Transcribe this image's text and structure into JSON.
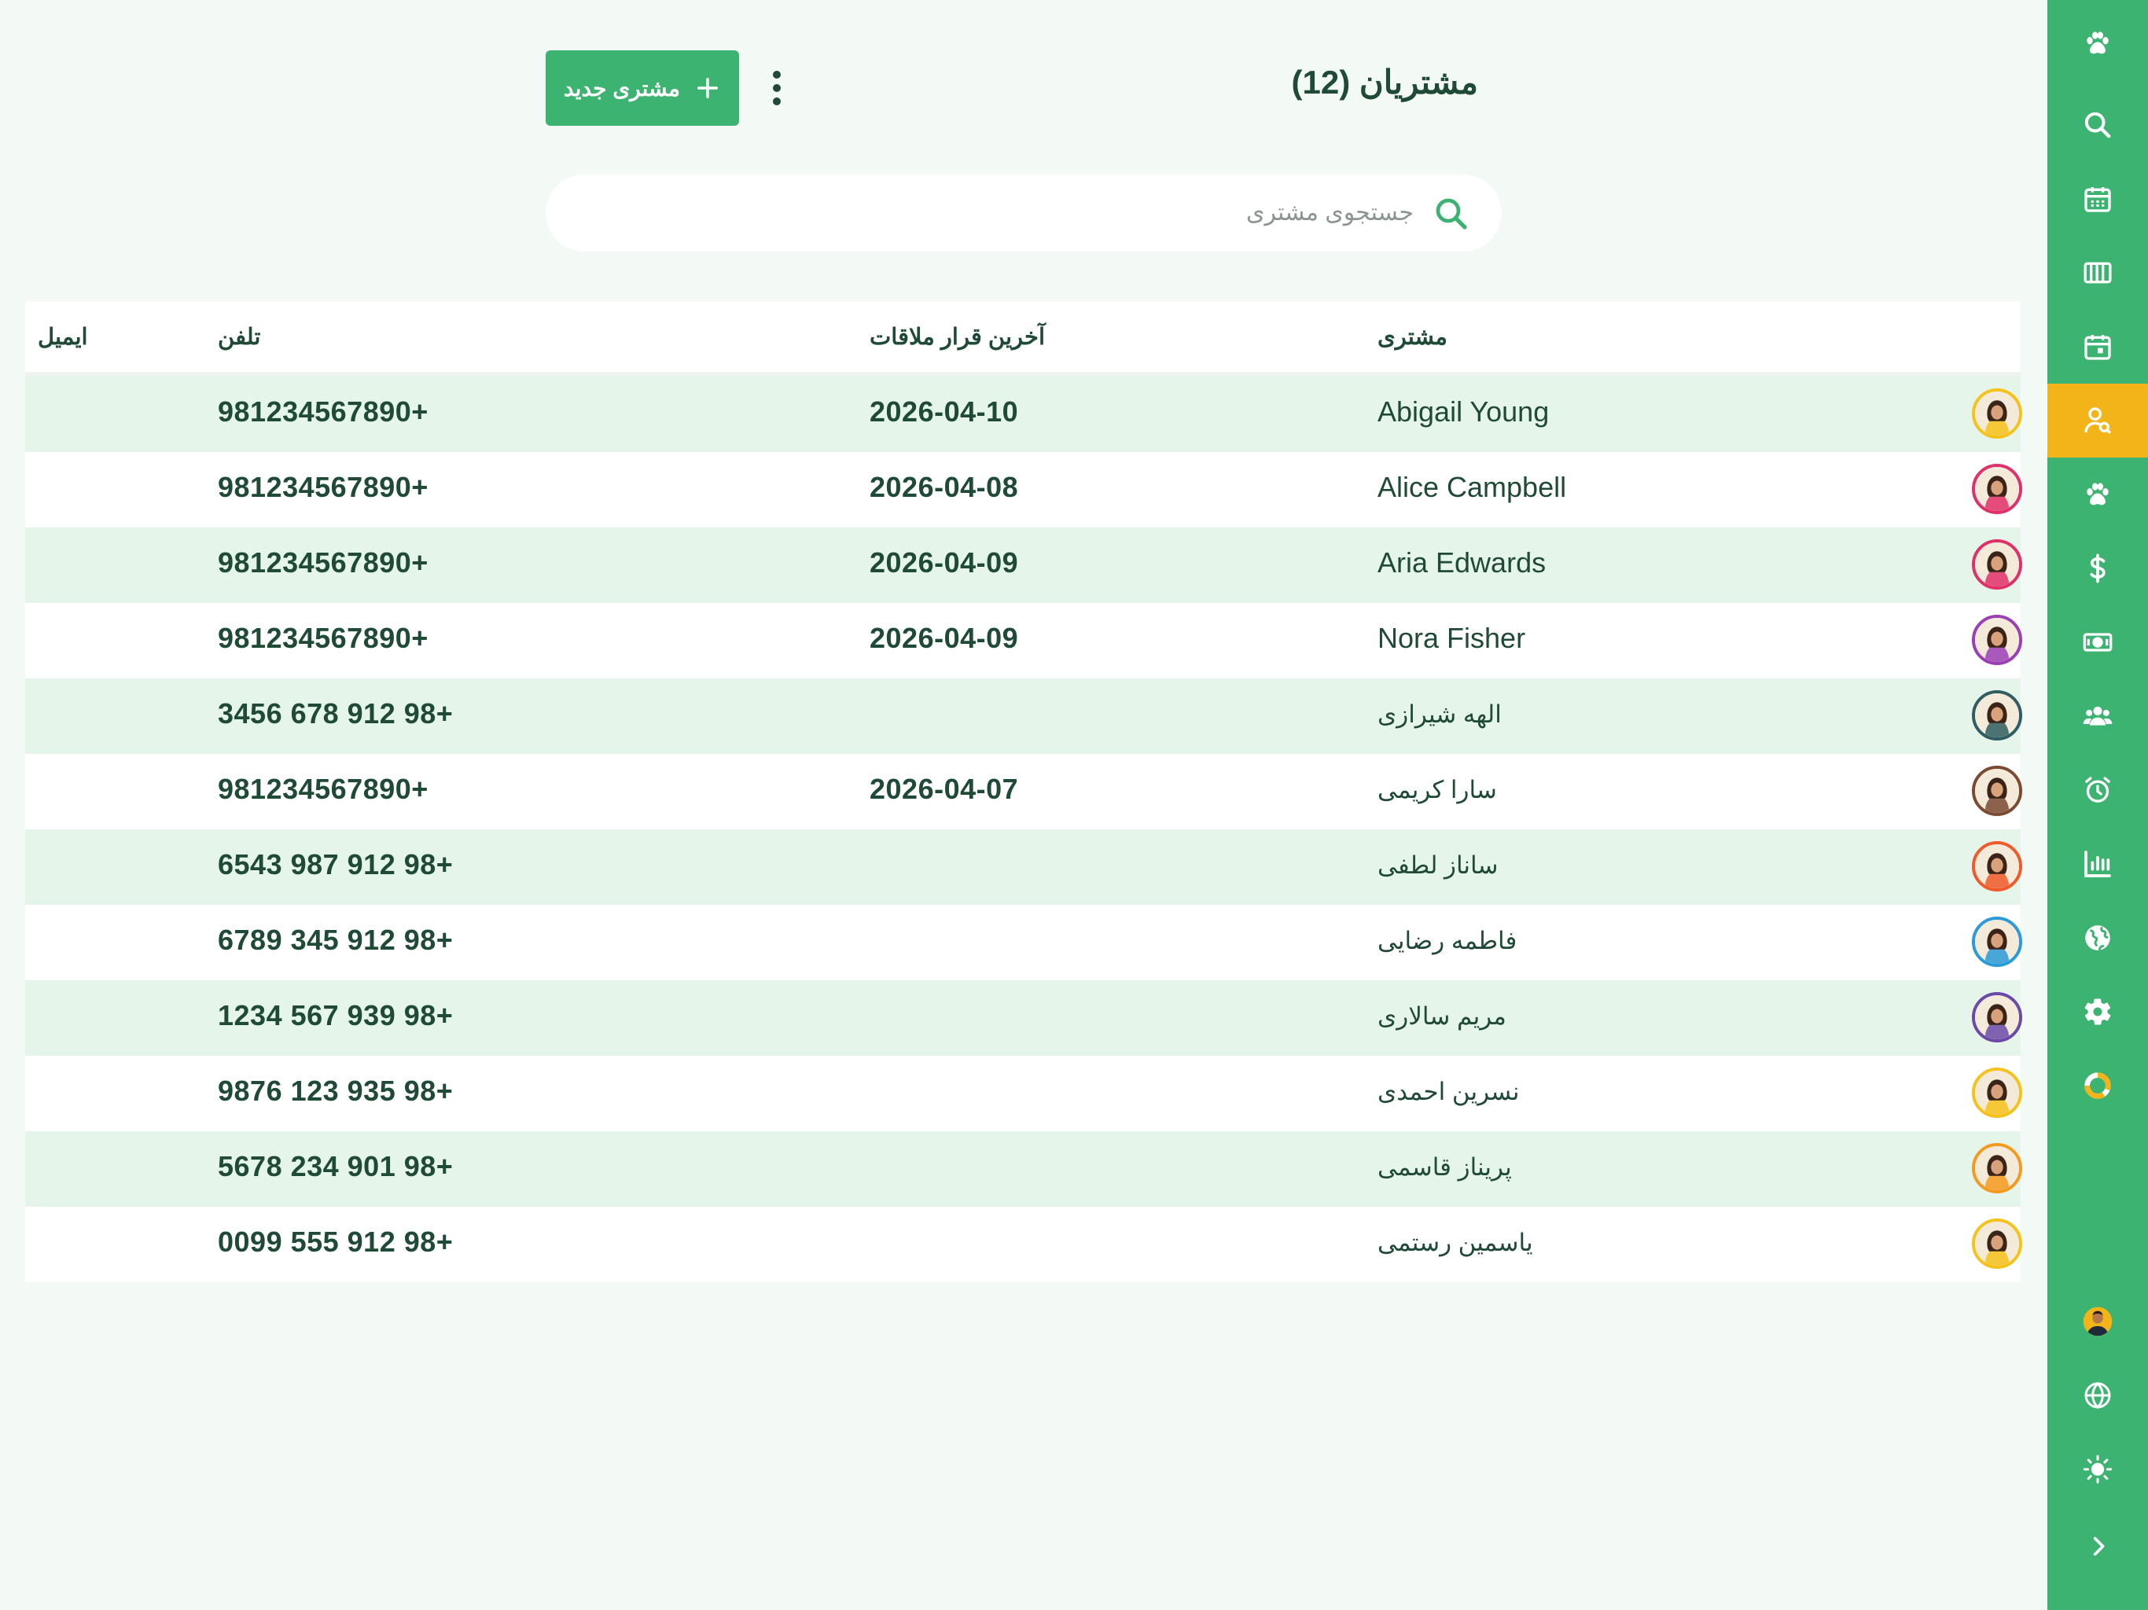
{
  "header": {
    "title": "مشتریان (12)",
    "new_button_label": "مشتری جدید"
  },
  "search": {
    "placeholder": "جستجوی مشتری",
    "value": ""
  },
  "table": {
    "columns": {
      "customer": "مشتری",
      "last_appointment": "آخرین قرار ملاقات",
      "phone": "تلفن",
      "email": "ایمیل"
    },
    "rows": [
      {
        "name": "Abigail Young",
        "last_appointment": "2026-04-10",
        "phone": "981234567890+",
        "email": "",
        "avatar_color": "#f5c21b"
      },
      {
        "name": "Alice Campbell",
        "last_appointment": "2026-04-08",
        "phone": "981234567890+",
        "email": "",
        "avatar_color": "#e0306a"
      },
      {
        "name": "Aria Edwards",
        "last_appointment": "2026-04-09",
        "phone": "981234567890+",
        "email": "",
        "avatar_color": "#e0306a"
      },
      {
        "name": "Nora Fisher",
        "last_appointment": "2026-04-09",
        "phone": "981234567890+",
        "email": "",
        "avatar_color": "#9b3fb5"
      },
      {
        "name": "الهه شیرازی",
        "last_appointment": "",
        "phone": "3456 678 912 98+",
        "email": "",
        "avatar_color": "#2f5d62"
      },
      {
        "name": "سارا کریمی",
        "last_appointment": "2026-04-07",
        "phone": "981234567890+",
        "email": "",
        "avatar_color": "#7a4a33"
      },
      {
        "name": "ساناز لطفی",
        "last_appointment": "",
        "phone": "6543 987 912 98+",
        "email": "",
        "avatar_color": "#f0592a"
      },
      {
        "name": "فاطمه رضایی",
        "last_appointment": "",
        "phone": "6789 345 912 98+",
        "email": "",
        "avatar_color": "#2a9ad8"
      },
      {
        "name": "مریم سالاری",
        "last_appointment": "",
        "phone": "1234 567 939 98+",
        "email": "",
        "avatar_color": "#6a4aa8"
      },
      {
        "name": "نسرین احمدی",
        "last_appointment": "",
        "phone": "9876 123 935 98+",
        "email": "",
        "avatar_color": "#f5c21b"
      },
      {
        "name": "پریناز قاسمی",
        "last_appointment": "",
        "phone": "5678 234 901 98+",
        "email": "",
        "avatar_color": "#f39a1f"
      },
      {
        "name": "یاسمین رستمی",
        "last_appointment": "",
        "phone": "0099 555 912 98+",
        "email": "",
        "avatar_color": "#f5c21b"
      }
    ]
  },
  "sidebar": {
    "items": [
      {
        "icon": "paw-icon"
      },
      {
        "icon": "search-icon"
      },
      {
        "icon": "calendar-grid-icon"
      },
      {
        "icon": "columns-icon"
      },
      {
        "icon": "calendar-day-icon"
      },
      {
        "icon": "user-search-icon",
        "active": true
      },
      {
        "icon": "paw-icon"
      },
      {
        "icon": "dollar-icon"
      },
      {
        "icon": "cash-icon"
      },
      {
        "icon": "users-icon"
      },
      {
        "icon": "alarm-icon"
      },
      {
        "icon": "bar-chart-icon"
      },
      {
        "icon": "globe-icon"
      },
      {
        "icon": "gear-icon"
      },
      {
        "icon": "donut-icon"
      }
    ],
    "bottom_items": [
      {
        "icon": "user-avatar-icon"
      },
      {
        "icon": "language-globe-icon"
      },
      {
        "icon": "sun-icon"
      },
      {
        "icon": "chevron-right-icon"
      }
    ]
  },
  "colors": {
    "primary": "#3cb371",
    "active": "#f3b41a",
    "background": "#f3f9f5",
    "row_alt": "#e6f5ea",
    "text": "#1f4a35"
  }
}
